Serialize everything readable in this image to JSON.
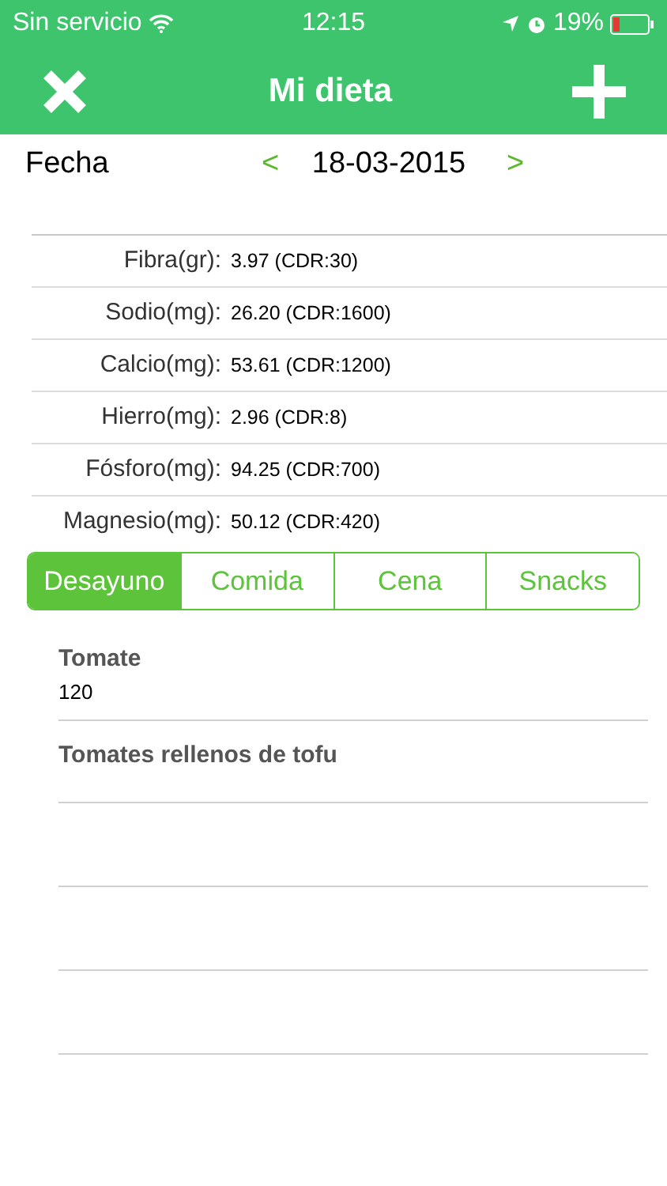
{
  "status_bar": {
    "carrier": "Sin servicio",
    "time": "12:15",
    "battery": "19%"
  },
  "nav": {
    "title": "Mi dieta"
  },
  "date_row": {
    "label": "Fecha",
    "prev": "<",
    "date": "18-03-2015",
    "next": ">"
  },
  "nutrients": [
    {
      "name": "Fibra(gr):",
      "value": "3.97 (CDR:30)"
    },
    {
      "name": "Sodio(mg):",
      "value": "26.20 (CDR:1600)"
    },
    {
      "name": "Calcio(mg):",
      "value": "53.61 (CDR:1200)"
    },
    {
      "name": "Hierro(mg):",
      "value": "2.96 (CDR:8)"
    },
    {
      "name": "Fósforo(mg):",
      "value": "94.25 (CDR:700)"
    },
    {
      "name": "Magnesio(mg):",
      "value": "50.12 (CDR:420)"
    }
  ],
  "tabs": [
    {
      "label": "Desayuno",
      "selected": true
    },
    {
      "label": "Comida",
      "selected": false
    },
    {
      "label": "Cena",
      "selected": false
    },
    {
      "label": "Snacks",
      "selected": false
    }
  ],
  "foods": [
    {
      "name": "Tomate",
      "amount": "120"
    },
    {
      "name": "Tomates rellenos de tofu"
    }
  ]
}
